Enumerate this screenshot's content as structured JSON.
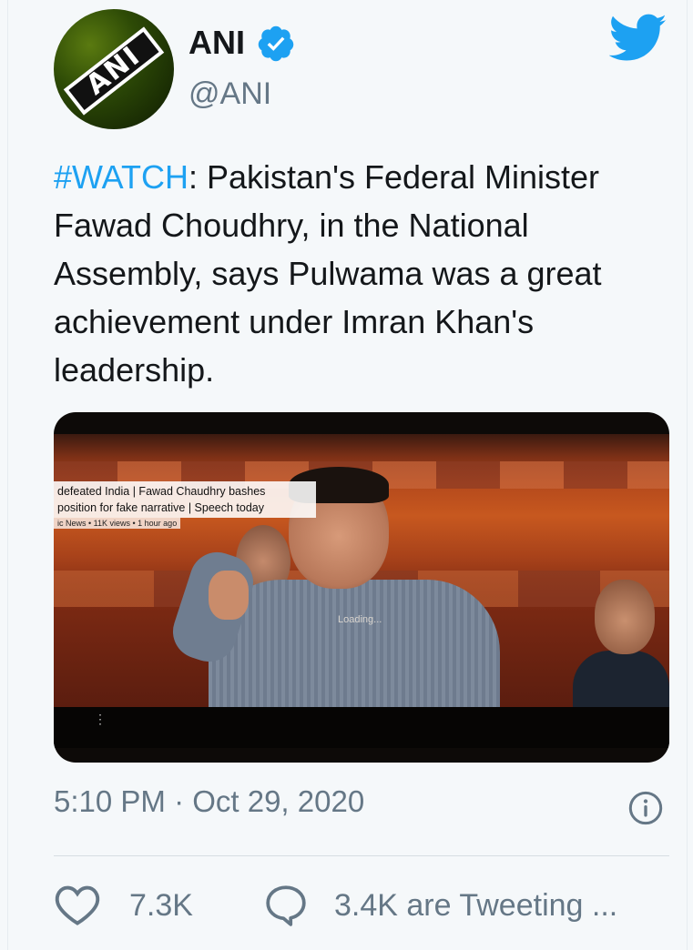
{
  "author": {
    "name": "ANI",
    "handle": "@ANI",
    "avatar_text": "ANI",
    "verified": true
  },
  "tweet": {
    "hashtag": "#WATCH",
    "body": ": Pakistan's Federal Minister Fawad Choudhry, in the National Assembly, says Pulwama was a great achievement under Imran Khan's leadership."
  },
  "media": {
    "overlay_line1": "defeated India | Fawad Chaudhry bashes",
    "overlay_line2": "position for fake narrative | Speech today",
    "overlay_meta": "ic News • 11K views • 1 hour ago",
    "loading_text": "Loading..."
  },
  "meta": {
    "timestamp": "5:10 PM · Oct 29, 2020"
  },
  "actions": {
    "like_count": "7.3K",
    "tweeting_text": "3.4K are Tweeting ..."
  },
  "colors": {
    "accent": "#1da1f2",
    "text": "#14171a",
    "muted": "#657786",
    "background": "#f5f8fa"
  },
  "icons": [
    "verified-badge-icon",
    "twitter-bird-icon",
    "info-icon",
    "heart-icon",
    "speech-bubble-icon",
    "kebab-menu-icon"
  ]
}
